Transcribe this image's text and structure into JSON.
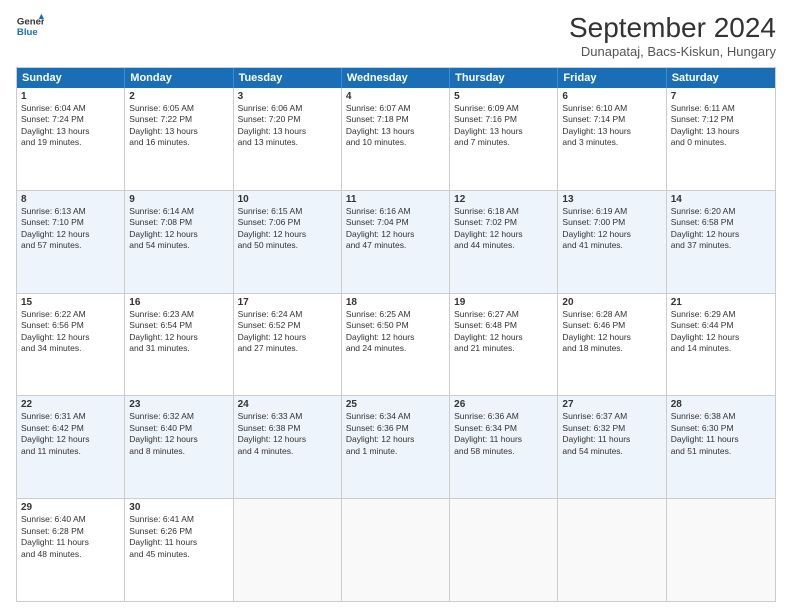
{
  "header": {
    "logo_line1": "General",
    "logo_line2": "Blue",
    "month_title": "September 2024",
    "location": "Dunapataj, Bacs-Kiskun, Hungary"
  },
  "days_of_week": [
    "Sunday",
    "Monday",
    "Tuesday",
    "Wednesday",
    "Thursday",
    "Friday",
    "Saturday"
  ],
  "weeks": [
    [
      {
        "day": "1",
        "lines": [
          "Sunrise: 6:04 AM",
          "Sunset: 7:24 PM",
          "Daylight: 13 hours",
          "and 19 minutes."
        ]
      },
      {
        "day": "2",
        "lines": [
          "Sunrise: 6:05 AM",
          "Sunset: 7:22 PM",
          "Daylight: 13 hours",
          "and 16 minutes."
        ]
      },
      {
        "day": "3",
        "lines": [
          "Sunrise: 6:06 AM",
          "Sunset: 7:20 PM",
          "Daylight: 13 hours",
          "and 13 minutes."
        ]
      },
      {
        "day": "4",
        "lines": [
          "Sunrise: 6:07 AM",
          "Sunset: 7:18 PM",
          "Daylight: 13 hours",
          "and 10 minutes."
        ]
      },
      {
        "day": "5",
        "lines": [
          "Sunrise: 6:09 AM",
          "Sunset: 7:16 PM",
          "Daylight: 13 hours",
          "and 7 minutes."
        ]
      },
      {
        "day": "6",
        "lines": [
          "Sunrise: 6:10 AM",
          "Sunset: 7:14 PM",
          "Daylight: 13 hours",
          "and 3 minutes."
        ]
      },
      {
        "day": "7",
        "lines": [
          "Sunrise: 6:11 AM",
          "Sunset: 7:12 PM",
          "Daylight: 13 hours",
          "and 0 minutes."
        ]
      }
    ],
    [
      {
        "day": "8",
        "lines": [
          "Sunrise: 6:13 AM",
          "Sunset: 7:10 PM",
          "Daylight: 12 hours",
          "and 57 minutes."
        ]
      },
      {
        "day": "9",
        "lines": [
          "Sunrise: 6:14 AM",
          "Sunset: 7:08 PM",
          "Daylight: 12 hours",
          "and 54 minutes."
        ]
      },
      {
        "day": "10",
        "lines": [
          "Sunrise: 6:15 AM",
          "Sunset: 7:06 PM",
          "Daylight: 12 hours",
          "and 50 minutes."
        ]
      },
      {
        "day": "11",
        "lines": [
          "Sunrise: 6:16 AM",
          "Sunset: 7:04 PM",
          "Daylight: 12 hours",
          "and 47 minutes."
        ]
      },
      {
        "day": "12",
        "lines": [
          "Sunrise: 6:18 AM",
          "Sunset: 7:02 PM",
          "Daylight: 12 hours",
          "and 44 minutes."
        ]
      },
      {
        "day": "13",
        "lines": [
          "Sunrise: 6:19 AM",
          "Sunset: 7:00 PM",
          "Daylight: 12 hours",
          "and 41 minutes."
        ]
      },
      {
        "day": "14",
        "lines": [
          "Sunrise: 6:20 AM",
          "Sunset: 6:58 PM",
          "Daylight: 12 hours",
          "and 37 minutes."
        ]
      }
    ],
    [
      {
        "day": "15",
        "lines": [
          "Sunrise: 6:22 AM",
          "Sunset: 6:56 PM",
          "Daylight: 12 hours",
          "and 34 minutes."
        ]
      },
      {
        "day": "16",
        "lines": [
          "Sunrise: 6:23 AM",
          "Sunset: 6:54 PM",
          "Daylight: 12 hours",
          "and 31 minutes."
        ]
      },
      {
        "day": "17",
        "lines": [
          "Sunrise: 6:24 AM",
          "Sunset: 6:52 PM",
          "Daylight: 12 hours",
          "and 27 minutes."
        ]
      },
      {
        "day": "18",
        "lines": [
          "Sunrise: 6:25 AM",
          "Sunset: 6:50 PM",
          "Daylight: 12 hours",
          "and 24 minutes."
        ]
      },
      {
        "day": "19",
        "lines": [
          "Sunrise: 6:27 AM",
          "Sunset: 6:48 PM",
          "Daylight: 12 hours",
          "and 21 minutes."
        ]
      },
      {
        "day": "20",
        "lines": [
          "Sunrise: 6:28 AM",
          "Sunset: 6:46 PM",
          "Daylight: 12 hours",
          "and 18 minutes."
        ]
      },
      {
        "day": "21",
        "lines": [
          "Sunrise: 6:29 AM",
          "Sunset: 6:44 PM",
          "Daylight: 12 hours",
          "and 14 minutes."
        ]
      }
    ],
    [
      {
        "day": "22",
        "lines": [
          "Sunrise: 6:31 AM",
          "Sunset: 6:42 PM",
          "Daylight: 12 hours",
          "and 11 minutes."
        ]
      },
      {
        "day": "23",
        "lines": [
          "Sunrise: 6:32 AM",
          "Sunset: 6:40 PM",
          "Daylight: 12 hours",
          "and 8 minutes."
        ]
      },
      {
        "day": "24",
        "lines": [
          "Sunrise: 6:33 AM",
          "Sunset: 6:38 PM",
          "Daylight: 12 hours",
          "and 4 minutes."
        ]
      },
      {
        "day": "25",
        "lines": [
          "Sunrise: 6:34 AM",
          "Sunset: 6:36 PM",
          "Daylight: 12 hours",
          "and 1 minute."
        ]
      },
      {
        "day": "26",
        "lines": [
          "Sunrise: 6:36 AM",
          "Sunset: 6:34 PM",
          "Daylight: 11 hours",
          "and 58 minutes."
        ]
      },
      {
        "day": "27",
        "lines": [
          "Sunrise: 6:37 AM",
          "Sunset: 6:32 PM",
          "Daylight: 11 hours",
          "and 54 minutes."
        ]
      },
      {
        "day": "28",
        "lines": [
          "Sunrise: 6:38 AM",
          "Sunset: 6:30 PM",
          "Daylight: 11 hours",
          "and 51 minutes."
        ]
      }
    ],
    [
      {
        "day": "29",
        "lines": [
          "Sunrise: 6:40 AM",
          "Sunset: 6:28 PM",
          "Daylight: 11 hours",
          "and 48 minutes."
        ]
      },
      {
        "day": "30",
        "lines": [
          "Sunrise: 6:41 AM",
          "Sunset: 6:26 PM",
          "Daylight: 11 hours",
          "and 45 minutes."
        ]
      },
      {
        "day": "",
        "lines": []
      },
      {
        "day": "",
        "lines": []
      },
      {
        "day": "",
        "lines": []
      },
      {
        "day": "",
        "lines": []
      },
      {
        "day": "",
        "lines": []
      }
    ]
  ],
  "alt_rows": [
    1,
    3
  ]
}
